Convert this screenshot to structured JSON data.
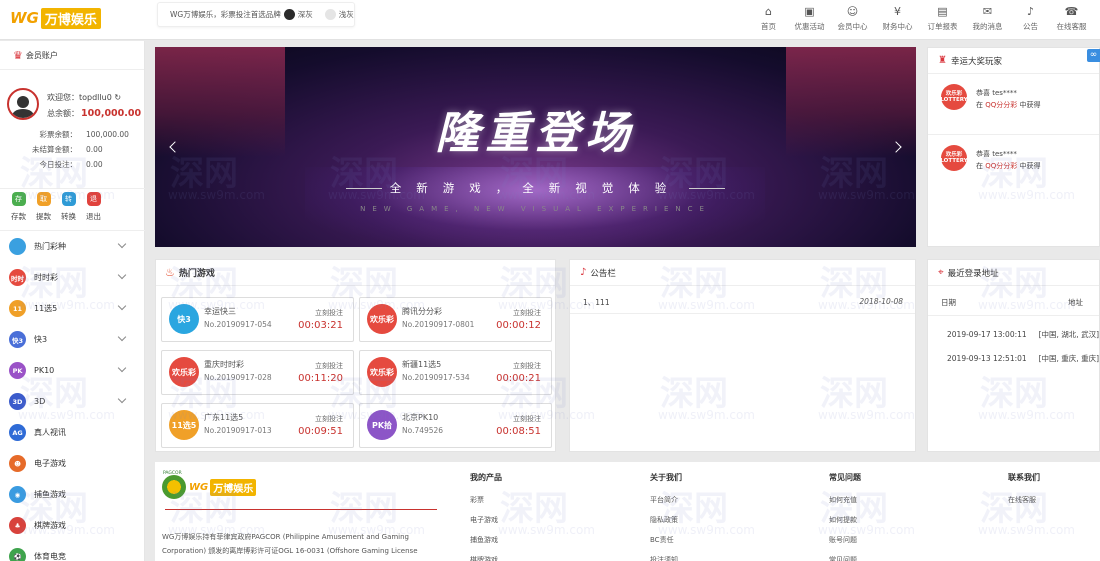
{
  "header": {
    "logo_prefix": "WG",
    "logo_name": "万博娱乐",
    "theme_label": "WG万博娱乐，彩票投注首选品牌",
    "theme_dark": "深灰",
    "theme_light": "浅灰",
    "nav": [
      {
        "label": "首页",
        "icon": "home-icon",
        "glyph": "⌂"
      },
      {
        "label": "优惠活动",
        "icon": "gift-icon",
        "glyph": "▣"
      },
      {
        "label": "会员中心",
        "icon": "user-icon",
        "glyph": "☺"
      },
      {
        "label": "财务中心",
        "icon": "finance-icon",
        "glyph": "¥"
      },
      {
        "label": "订单报表",
        "icon": "report-icon",
        "glyph": "▤"
      },
      {
        "label": "我的消息",
        "icon": "message-icon",
        "glyph": "✉"
      },
      {
        "label": "公告",
        "icon": "bell-icon",
        "glyph": "♪"
      },
      {
        "label": "在线客服",
        "icon": "service-icon",
        "glyph": "☎"
      }
    ]
  },
  "sidebar": {
    "title": "会员账户",
    "welcome": "欢迎您：topdllu0",
    "total_label": "总余额：",
    "total_value": "100,000.00",
    "rows": [
      {
        "k": "彩票余额：",
        "v": "100,000.00"
      },
      {
        "k": "未结算金额：",
        "v": "0.00"
      },
      {
        "k": "今日投注：",
        "v": "0.00"
      }
    ],
    "wallet": [
      {
        "c": "存",
        "label": "存款",
        "color": "#4bae4f"
      },
      {
        "c": "取",
        "label": "提款",
        "color": "#f0a028"
      },
      {
        "c": "转",
        "label": "转换",
        "color": "#2f9bd6"
      },
      {
        "c": "退",
        "label": "退出",
        "color": "#e0423c"
      }
    ],
    "menu": [
      {
        "label": "热门彩种",
        "icon": "globe",
        "color": "#3aa0e0",
        "text": "",
        "chev": true
      },
      {
        "label": "时时彩",
        "icon": "ssc",
        "color": "#e54a3f",
        "text": "时时",
        "chev": true
      },
      {
        "label": "11选5",
        "icon": "11x5",
        "color": "#f0a028",
        "text": "11",
        "chev": true
      },
      {
        "label": "快3",
        "icon": "k3",
        "color": "#4a6fd8",
        "text": "快3",
        "chev": true
      },
      {
        "label": "PK10",
        "icon": "pk10",
        "color": "#9a52c7",
        "text": "PK",
        "chev": true
      },
      {
        "label": "3D",
        "icon": "3d",
        "color": "#3b5bcb",
        "text": "3D",
        "chev": true
      },
      {
        "label": "真人视讯",
        "icon": "ag",
        "color": "#2f6bd6",
        "text": "AG",
        "chev": false
      },
      {
        "label": "电子游戏",
        "icon": "slot",
        "color": "#e66b2a",
        "text": "☻",
        "chev": false
      },
      {
        "label": "捕鱼游戏",
        "icon": "fish",
        "color": "#3a9be0",
        "text": "◉",
        "chev": false
      },
      {
        "label": "棋牌游戏",
        "icon": "cards",
        "color": "#d8423c",
        "text": "♣",
        "chev": false
      },
      {
        "label": "体育电竞",
        "icon": "sport",
        "color": "#3fa34d",
        "text": "⚽",
        "chev": false
      }
    ]
  },
  "banner": {
    "title": "隆重登场",
    "subtitle": "全新游戏，全新视觉体验",
    "english": "NEW GAME, NEW VISUAL EXPERIENCE"
  },
  "winners": {
    "title": "幸运大奖玩家",
    "items": [
      {
        "l1": "恭喜 tes****",
        "pre": "在 ",
        "game": "QQ分分彩",
        "post": " 中获得",
        "logo": "欢乐彩 LOTTERY"
      },
      {
        "l1": "恭喜 tes****",
        "pre": "在 ",
        "game": "QQ分分彩",
        "post": " 中获得",
        "logo": "欢乐彩 LOTTERY"
      }
    ]
  },
  "hot": {
    "title": "热门游戏",
    "bet_label": "立刻投注",
    "games": [
      {
        "name": "幸运快三",
        "no": "No.20190917-054",
        "time": "00:03:21",
        "color": "#2aa6e0",
        "icon": "快3"
      },
      {
        "name": "腾讯分分彩",
        "no": "No.20190917-0801",
        "time": "00:00:12",
        "color": "#e54a3f",
        "icon": "欢乐彩"
      },
      {
        "name": "重庆时时彩",
        "no": "No.20190917-028",
        "time": "00:11:20",
        "color": "#e54a3f",
        "icon": "欢乐彩"
      },
      {
        "name": "新疆11选5",
        "no": "No.20190917-534",
        "time": "00:00:21",
        "color": "#e54a3f",
        "icon": "欢乐彩"
      },
      {
        "name": "广东11选5",
        "no": "No.20190917-013",
        "time": "00:09:51",
        "color": "#f0a028",
        "icon": "11选5"
      },
      {
        "name": "北京PK10",
        "no": "No.749526",
        "time": "00:08:51",
        "color": "#8c55c7",
        "icon": "PK拾"
      }
    ]
  },
  "notice": {
    "title": "公告栏",
    "items": [
      {
        "text": "1、111",
        "date": "2018-10-08"
      }
    ]
  },
  "login": {
    "title": "最近登录地址",
    "col_date": "日期",
    "col_addr": "地址",
    "rows": [
      {
        "date": "2019-09-17 13:00:11",
        "addr": "[中国, 湖北, 武汉]"
      },
      {
        "date": "2019-09-13 12:51:01",
        "addr": "[中国, 重庆, 重庆]"
      }
    ]
  },
  "footer": {
    "pagcor": "PAGCOR",
    "logo_prefix": "WG",
    "logo_name": "万博娱乐",
    "desc": "WG万博娱乐持有菲律宾政府PAGCOR (Philippine Amusement and Gaming Corporation) 颁发的离岸博彩许可证OGL 16-0031 (Offshore Gaming License",
    "cols": [
      {
        "title": "我的产品",
        "links": [
          "彩票",
          "电子游戏",
          "捕鱼游戏",
          "棋牌游戏"
        ]
      },
      {
        "title": "关于我们",
        "links": [
          "平台简介",
          "隐私政策",
          "BC责任",
          "投注须知"
        ]
      },
      {
        "title": "常见问题",
        "links": [
          "如何充值",
          "如何提款",
          "账号问题",
          "常见问题"
        ]
      },
      {
        "title": "联系我们",
        "links": [
          "在线客服"
        ]
      }
    ]
  },
  "watermark": {
    "big": "深网",
    "small": "www.sw9m.com"
  }
}
